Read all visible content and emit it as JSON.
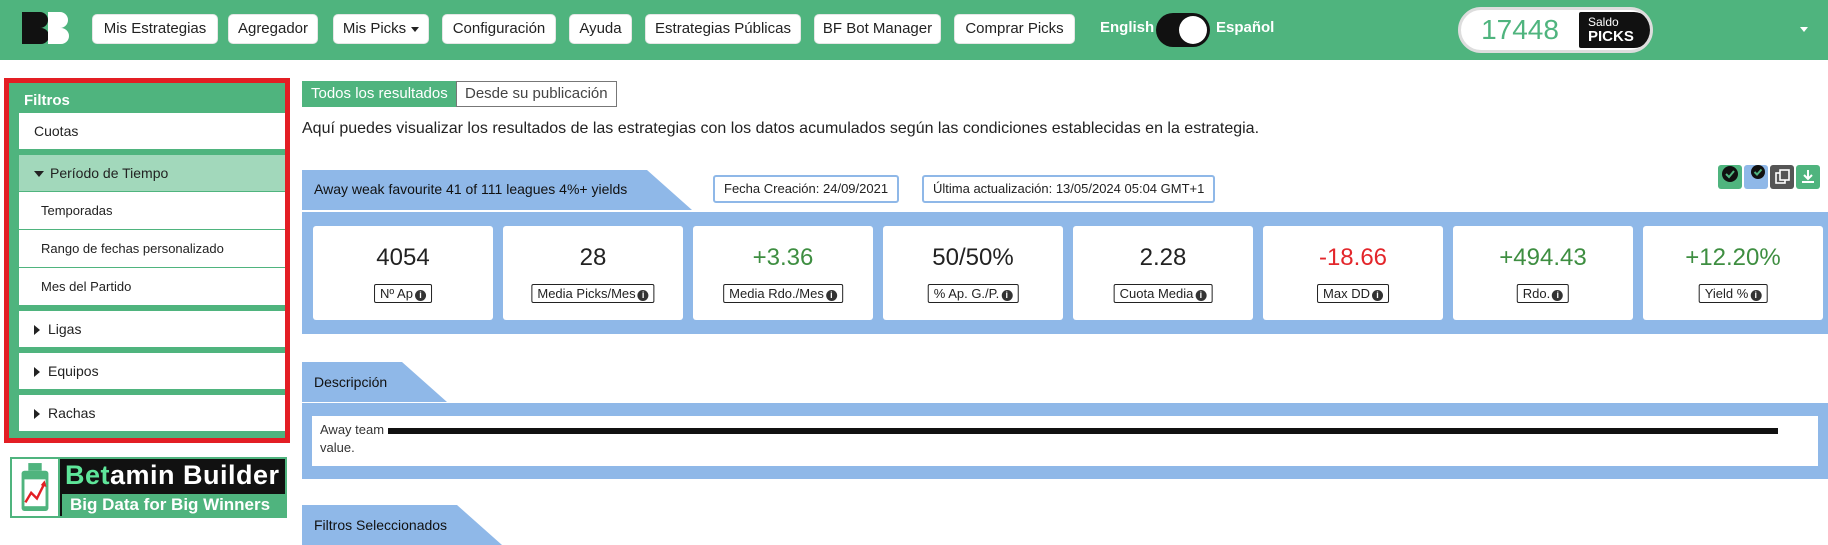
{
  "nav": {
    "items": [
      "Mis Estrategias",
      "Agregador",
      "Mis Picks",
      "Configuración",
      "Ayuda",
      "Estrategias Públicas",
      "BF Bot Manager",
      "Comprar Picks"
    ],
    "lang_en": "English",
    "lang_es": "Español",
    "language_selected": "Español",
    "saldo_value": "17448",
    "saldo_label": "Saldo",
    "saldo_unit": "PICKS"
  },
  "sidebar": {
    "title": "Filtros",
    "cuotas": "Cuotas",
    "periodo": "Período de Tiempo",
    "periodo_sub": [
      "Temporadas",
      "Rango de fechas personalizado",
      "Mes del Partido"
    ],
    "ligas": "Ligas",
    "equipos": "Equipos",
    "rachas": "Rachas"
  },
  "brand": {
    "name_a": "Bet",
    "name_b": "amin Builder",
    "tagline": "Big Data for Big Winners"
  },
  "tabs": {
    "all": "Todos los resultados",
    "since": "Desde su publicación"
  },
  "intro": "Aquí puedes visualizar los resultados de las estrategias con los datos acumulados según las condiciones establecidas en la estrategia.",
  "strategy": {
    "title": "Away weak favourite 41 of 111 leagues 4%+ yields",
    "created": "Fecha Creación: 24/09/2021",
    "updated": "Última actualización: 13/05/2024 05:04 GMT+1"
  },
  "stats": [
    {
      "value": "4054",
      "label": "Nº Ap",
      "color": "#222222"
    },
    {
      "value": "28",
      "label": "Media Picks/Mes",
      "color": "#222222"
    },
    {
      "value": "+3.36",
      "label": "Media Rdo./Mes",
      "color": "#3e8e41"
    },
    {
      "value": "50/50%",
      "label": "% Ap. G./P.",
      "color": "#222222"
    },
    {
      "value": "2.28",
      "label": "Cuota Media",
      "color": "#222222"
    },
    {
      "value": "-18.66",
      "label": "Max DD",
      "color": "#e3262b"
    },
    {
      "value": "+494.43",
      "label": "Rdo.",
      "color": "#3e8e41"
    },
    {
      "value": "+12.20%",
      "label": "Yield %",
      "color": "#3e8e41"
    }
  ],
  "description": {
    "title": "Descripción",
    "text_start": "Away team",
    "text_end": "value."
  },
  "filters_selected": "Filtros Seleccionados",
  "colors": {
    "brand_green": "#4fb47e",
    "band_blue": "#8fb8e8",
    "negative_red": "#e3262b",
    "positive_green": "#3e8e41",
    "highlight_red": "#e31e24"
  },
  "icons": [
    "check-circle-icon",
    "check-circle-icon",
    "copy-icon",
    "download-icon"
  ]
}
